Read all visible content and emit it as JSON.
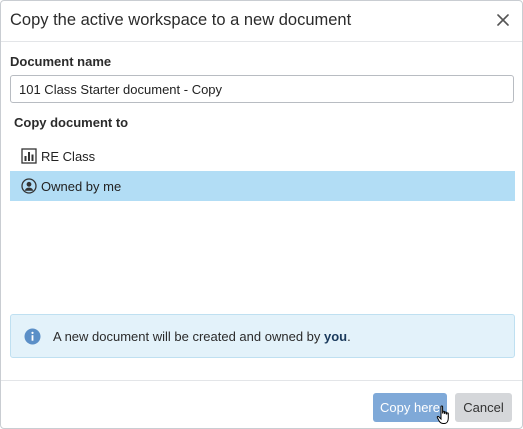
{
  "dialog": {
    "title": "Copy the active workspace to a new document",
    "close_icon": "close-icon"
  },
  "document_name": {
    "label": "Document name",
    "value": "101 Class Starter document - Copy"
  },
  "copy_to": {
    "label": "Copy document to",
    "items": [
      {
        "label": "RE Class",
        "icon": "classroom-icon",
        "selected": false
      },
      {
        "label": "Owned by me",
        "icon": "user-icon",
        "selected": true
      }
    ]
  },
  "info": {
    "icon": "info-icon",
    "text_prefix": "A new document will be created and owned by ",
    "owner": "you",
    "text_suffix": "."
  },
  "footer": {
    "copy_label": "Copy here",
    "cancel_label": "Cancel"
  },
  "colors": {
    "selected_row": "#b2ddf5",
    "primary_button": "#7fa9d8",
    "info_background": "#e3f2fa"
  }
}
